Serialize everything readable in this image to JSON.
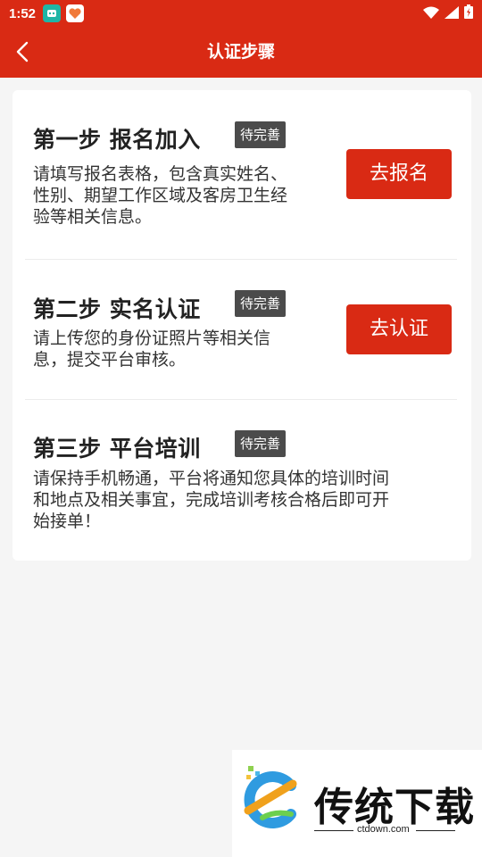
{
  "status_bar": {
    "time": "1:52"
  },
  "header": {
    "title": "认证步骤"
  },
  "steps": [
    {
      "title": "第一步 报名加入",
      "badge": "待完善",
      "desc_lines": [
        "请填写报名表格，包含真实姓名、",
        "性别、期望工作区域及客房卫生经",
        "验等相关信息。"
      ],
      "button": "去报名"
    },
    {
      "title": "第二步 实名认证",
      "badge": "待完善",
      "desc_lines": [
        "请上传您的身份证照片等相关信",
        "息，提交平台审核。"
      ],
      "button": "去认证"
    },
    {
      "title": "第三步 平台培训",
      "badge": "待完善",
      "desc_lines": [
        "请保持手机畅通，平台将通知您具体的培训时间",
        "和地点及相关事宜，完成培训考核合格后即可开",
        "始接单！"
      ]
    }
  ],
  "watermark": {
    "name": "传统下载",
    "url": "ctdown.com"
  },
  "colors": {
    "primary": "#d92a14",
    "badge": "#4b4b4b",
    "background": "#f5f5f5"
  }
}
